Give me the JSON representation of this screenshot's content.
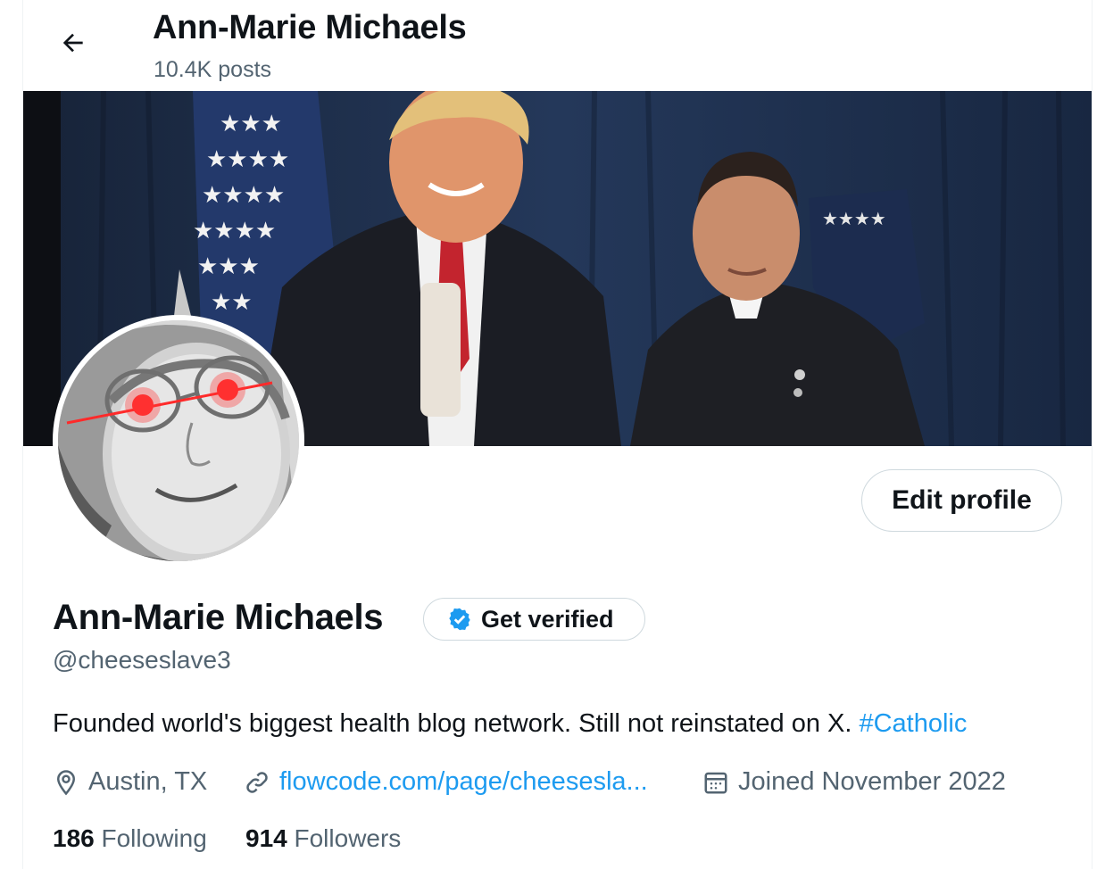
{
  "header": {
    "title": "Ann-Marie Michaels",
    "posts_count": "10.4K posts"
  },
  "profile": {
    "display_name": "Ann-Marie Michaels",
    "handle": "@cheeseslave3",
    "edit_label": "Edit profile",
    "verify_label": "Get verified",
    "bio_text": "Founded world's biggest health blog network. Still not reinstated on X. ",
    "bio_hashtag": "#Catholic",
    "location": "Austin, TX",
    "website": "flowcode.com/page/cheesesla...",
    "joined": "Joined November 2022",
    "following_count": "186",
    "following_label": "Following",
    "followers_count": "914",
    "followers_label": "Followers"
  },
  "colors": {
    "accent": "#1d9bf0",
    "muted": "#536471",
    "text": "#0f1419",
    "border": "#cfd9de"
  },
  "icons": [
    "back-arrow-icon",
    "verified-badge-icon",
    "location-pin-icon",
    "link-icon",
    "calendar-icon"
  ]
}
